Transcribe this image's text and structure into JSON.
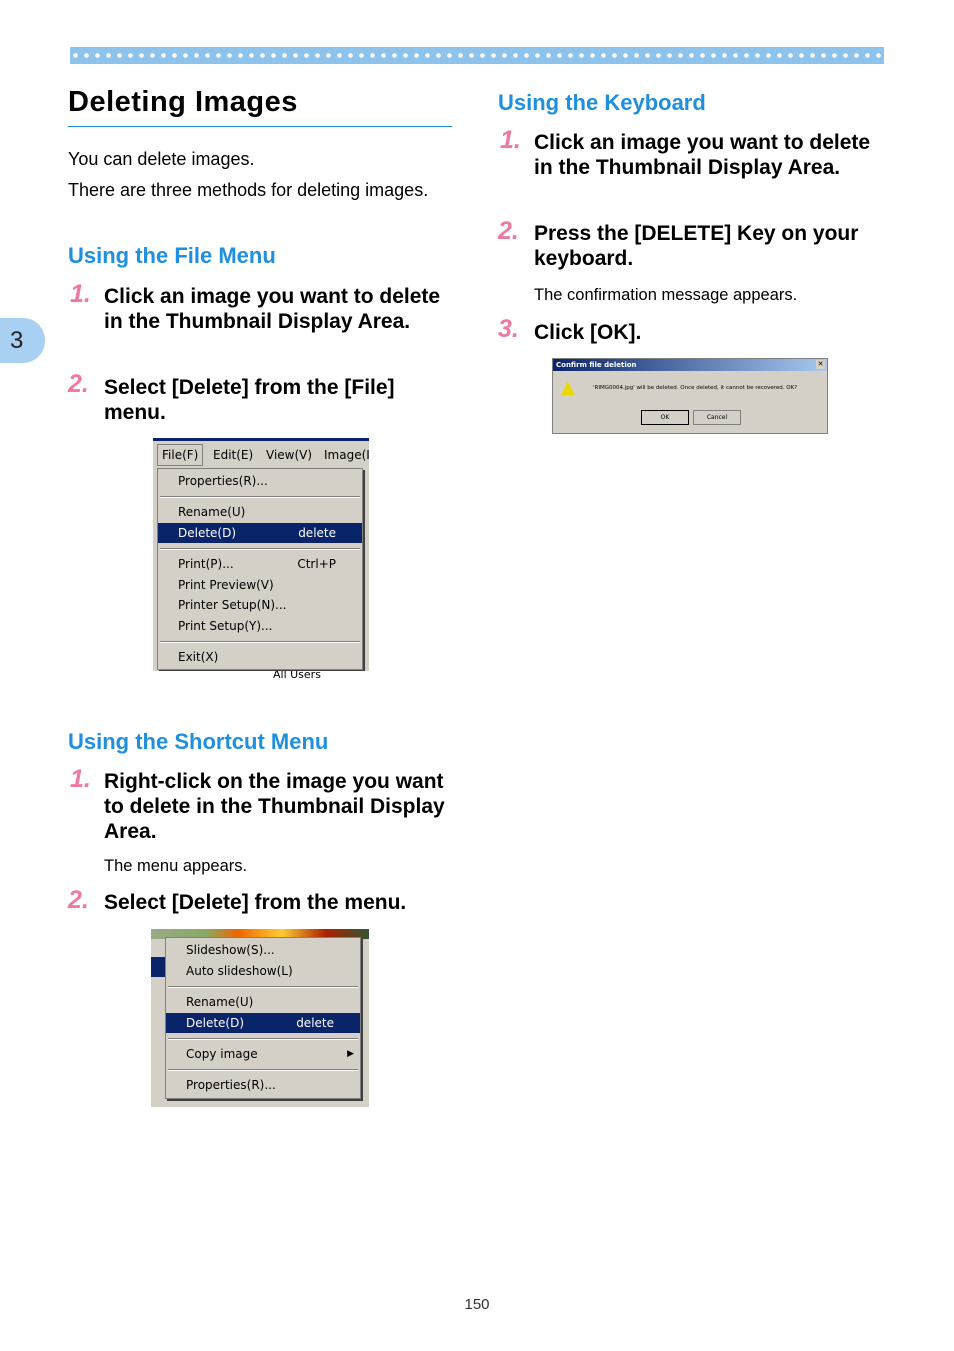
{
  "chapter_tab": "3",
  "title": "Deleting Images",
  "intro": [
    "You can delete images.",
    "There are three methods for deleting images."
  ],
  "file_menu": {
    "heading": "Using the File Menu",
    "steps": [
      {
        "num": "1.",
        "text": "Click an image you want to delete in the Thumbnail Display Area."
      },
      {
        "num": "2.",
        "text": "Select [Delete] from the [File] menu."
      }
    ],
    "screenshot": {
      "menubar": [
        "File(F)",
        "Edit(E)",
        "View(V)",
        "Image(I"
      ],
      "items": [
        {
          "label": "Properties(R)..."
        },
        {
          "label": "Rename(U)"
        },
        {
          "label": "Delete(D)",
          "shortcut": "delete",
          "selected": true
        },
        {
          "label": "Print(P)...",
          "shortcut": "Ctrl+P"
        },
        {
          "label": "Print Preview(V)"
        },
        {
          "label": "Printer Setup(N)..."
        },
        {
          "label": "Print Setup(Y)..."
        },
        {
          "label": "Exit(X)"
        }
      ],
      "background_text": "All Users"
    }
  },
  "shortcut_menu": {
    "heading": "Using the Shortcut Menu",
    "steps": [
      {
        "num": "1.",
        "text": "Right-click on the image you want to delete in the Thumbnail Display Area.",
        "note": "The menu appears."
      },
      {
        "num": "2.",
        "text": "Select [Delete] from the menu."
      }
    ],
    "screenshot": {
      "items": [
        {
          "label": "Slideshow(S)..."
        },
        {
          "label": "Auto slideshow(L)"
        },
        {
          "label": "Rename(U)"
        },
        {
          "label": "Delete(D)",
          "shortcut": "delete",
          "selected": true
        },
        {
          "label": "Copy image",
          "submenu": true
        },
        {
          "label": "Properties(R)..."
        }
      ]
    }
  },
  "keyboard": {
    "heading": "Using the Keyboard",
    "steps": [
      {
        "num": "1.",
        "text": "Click an image you want to delete in the Thumbnail Display Area."
      },
      {
        "num": "2.",
        "text": "Press the [DELETE] Key on your keyboard.",
        "note": "The confirmation message appears."
      },
      {
        "num": "3.",
        "text": "Click [OK]."
      }
    ],
    "dialog": {
      "title": "Confirm file deletion",
      "message": "'RIMG0004.jpg' will be deleted. Once deleted, it cannot be recovered. OK?",
      "ok": "OK",
      "cancel": "Cancel",
      "icon": "warning-icon"
    }
  },
  "page_number": "150",
  "colors": {
    "heading": "#1f8fe0",
    "step_number": "#ee7aa2",
    "band": "#8ec4ec",
    "menu_highlight": "#0a246a"
  }
}
